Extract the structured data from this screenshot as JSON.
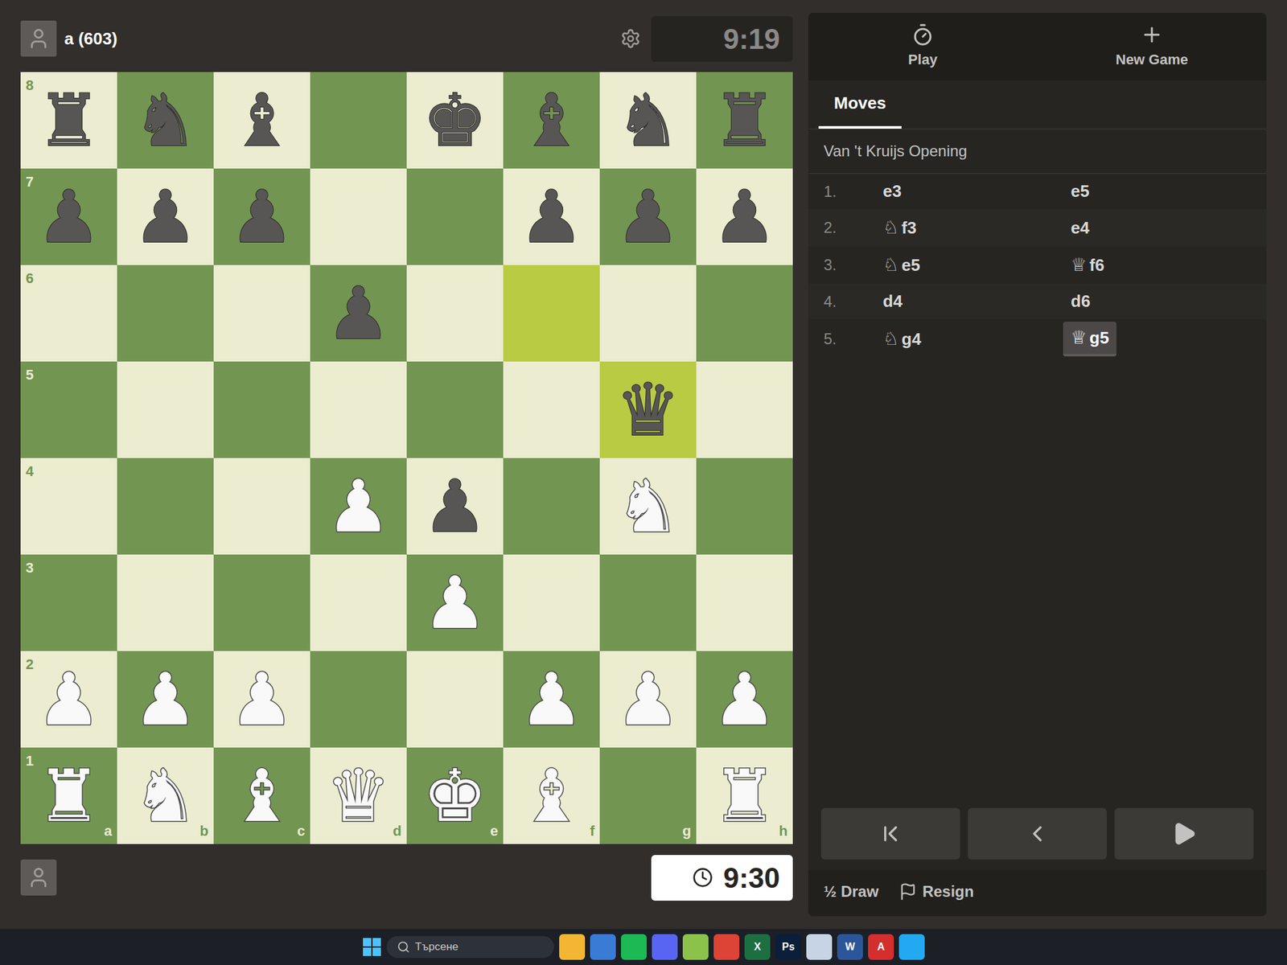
{
  "opponent": {
    "name": "a (603)",
    "clock": "9:19",
    "active": false
  },
  "player": {
    "clock": "9:30",
    "active": true
  },
  "board": {
    "files": [
      "a",
      "b",
      "c",
      "d",
      "e",
      "f",
      "g",
      "h"
    ],
    "ranks": [
      {
        "label": "8",
        "squares": [
          {
            "piece": "♜",
            "side": "black",
            "highlighted": false
          },
          {
            "piece": "♞",
            "side": "black",
            "highlighted": false
          },
          {
            "piece": "♝",
            "side": "black",
            "highlighted": false
          },
          {
            "piece": "",
            "side": "",
            "highlighted": false
          },
          {
            "piece": "♚",
            "side": "black",
            "highlighted": false
          },
          {
            "piece": "♝",
            "side": "black",
            "highlighted": false
          },
          {
            "piece": "♞",
            "side": "black",
            "highlighted": false
          },
          {
            "piece": "♜",
            "side": "black",
            "highlighted": false
          }
        ]
      },
      {
        "label": "7",
        "squares": [
          {
            "piece": "♟",
            "side": "black",
            "highlighted": false
          },
          {
            "piece": "♟",
            "side": "black",
            "highlighted": false
          },
          {
            "piece": "♟",
            "side": "black",
            "highlighted": false
          },
          {
            "piece": "",
            "side": "",
            "highlighted": false
          },
          {
            "piece": "",
            "side": "",
            "highlighted": false
          },
          {
            "piece": "♟",
            "side": "black",
            "highlighted": false
          },
          {
            "piece": "♟",
            "side": "black",
            "highlighted": false
          },
          {
            "piece": "♟",
            "side": "black",
            "highlighted": false
          }
        ]
      },
      {
        "label": "6",
        "squares": [
          {
            "piece": "",
            "side": "",
            "highlighted": false
          },
          {
            "piece": "",
            "side": "",
            "highlighted": false
          },
          {
            "piece": "",
            "side": "",
            "highlighted": false
          },
          {
            "piece": "♟",
            "side": "black",
            "highlighted": false
          },
          {
            "piece": "",
            "side": "",
            "highlighted": false
          },
          {
            "piece": "",
            "side": "",
            "highlighted": true
          },
          {
            "piece": "",
            "side": "",
            "highlighted": false
          },
          {
            "piece": "",
            "side": "",
            "highlighted": false
          }
        ]
      },
      {
        "label": "5",
        "squares": [
          {
            "piece": "",
            "side": "",
            "highlighted": false
          },
          {
            "piece": "",
            "side": "",
            "highlighted": false
          },
          {
            "piece": "",
            "side": "",
            "highlighted": false
          },
          {
            "piece": "",
            "side": "",
            "highlighted": false
          },
          {
            "piece": "",
            "side": "",
            "highlighted": false
          },
          {
            "piece": "",
            "side": "",
            "highlighted": false
          },
          {
            "piece": "♛",
            "side": "black",
            "highlighted": true
          },
          {
            "piece": "",
            "side": "",
            "highlighted": false
          }
        ]
      },
      {
        "label": "4",
        "squares": [
          {
            "piece": "",
            "side": "",
            "highlighted": false
          },
          {
            "piece": "",
            "side": "",
            "highlighted": false
          },
          {
            "piece": "",
            "side": "",
            "highlighted": false
          },
          {
            "piece": "♟",
            "side": "white",
            "highlighted": false
          },
          {
            "piece": "♟",
            "side": "black",
            "highlighted": false
          },
          {
            "piece": "",
            "side": "",
            "highlighted": false
          },
          {
            "piece": "♞",
            "side": "white",
            "highlighted": false
          },
          {
            "piece": "",
            "side": "",
            "highlighted": false
          }
        ]
      },
      {
        "label": "3",
        "squares": [
          {
            "piece": "",
            "side": "",
            "highlighted": false
          },
          {
            "piece": "",
            "side": "",
            "highlighted": false
          },
          {
            "piece": "",
            "side": "",
            "highlighted": false
          },
          {
            "piece": "",
            "side": "",
            "highlighted": false
          },
          {
            "piece": "♟",
            "side": "white",
            "highlighted": false
          },
          {
            "piece": "",
            "side": "",
            "highlighted": false
          },
          {
            "piece": "",
            "side": "",
            "highlighted": false
          },
          {
            "piece": "",
            "side": "",
            "highlighted": false
          }
        ]
      },
      {
        "label": "2",
        "squares": [
          {
            "piece": "♟",
            "side": "white",
            "highlighted": false
          },
          {
            "piece": "♟",
            "side": "white",
            "highlighted": false
          },
          {
            "piece": "♟",
            "side": "white",
            "highlighted": false
          },
          {
            "piece": "",
            "side": "",
            "highlighted": false
          },
          {
            "piece": "",
            "side": "",
            "highlighted": false
          },
          {
            "piece": "♟",
            "side": "white",
            "highlighted": false
          },
          {
            "piece": "♟",
            "side": "white",
            "highlighted": false
          },
          {
            "piece": "♟",
            "side": "white",
            "highlighted": false
          }
        ]
      },
      {
        "label": "1",
        "squares": [
          {
            "piece": "♜",
            "side": "white",
            "highlighted": false
          },
          {
            "piece": "♞",
            "side": "white",
            "highlighted": false
          },
          {
            "piece": "♝",
            "side": "white",
            "highlighted": false
          },
          {
            "piece": "♛",
            "side": "white",
            "highlighted": false
          },
          {
            "piece": "♚",
            "side": "white",
            "highlighted": false
          },
          {
            "piece": "♝",
            "side": "white",
            "highlighted": false
          },
          {
            "piece": "",
            "side": "",
            "highlighted": false
          },
          {
            "piece": "♜",
            "side": "white",
            "highlighted": false
          }
        ]
      }
    ]
  },
  "panel": {
    "header_buttons": [
      "Play",
      "New Game"
    ],
    "tabs": [
      {
        "label": "Moves",
        "selected": true
      }
    ],
    "opening": "Van 't Kruijs Opening",
    "moves": [
      {
        "number": "1.",
        "white": {
          "piece": "",
          "square": "e3",
          "selected": false
        },
        "black": {
          "piece": "",
          "square": "e5",
          "selected": false
        }
      },
      {
        "number": "2.",
        "white": {
          "piece": "♘",
          "square": "f3",
          "selected": false
        },
        "black": {
          "piece": "",
          "square": "e4",
          "selected": false
        }
      },
      {
        "number": "3.",
        "white": {
          "piece": "♘",
          "square": "e5",
          "selected": false
        },
        "black": {
          "piece": "♕",
          "square": "f6",
          "selected": false
        }
      },
      {
        "number": "4.",
        "white": {
          "piece": "",
          "square": "d4",
          "selected": false
        },
        "black": {
          "piece": "",
          "square": "d6",
          "selected": false
        }
      },
      {
        "number": "5.",
        "white": {
          "piece": "♘",
          "square": "g4",
          "selected": false
        },
        "black": {
          "piece": "♕",
          "square": "g5",
          "selected": true
        }
      }
    ],
    "draw_button": "½ Draw",
    "resign_button": "Resign"
  },
  "taskbar": {
    "search_placeholder": "Търсене",
    "apps": [
      {
        "label": "",
        "color": "#f2b632"
      },
      {
        "label": "",
        "color": "#3a7bd5"
      },
      {
        "label": "",
        "color": "#1db954"
      },
      {
        "label": "",
        "color": "#5865f2"
      },
      {
        "label": "",
        "color": "#8bc34a"
      },
      {
        "label": "",
        "color": "#db4437"
      },
      {
        "label": "X",
        "color": "#1d6f42"
      },
      {
        "label": "Ps",
        "color": "#0b1f3a"
      },
      {
        "label": "",
        "color": "#c7d4e6"
      },
      {
        "label": "W",
        "color": "#2b579a"
      },
      {
        "label": "A",
        "color": "#d32f2f"
      },
      {
        "label": "",
        "color": "#23a9f2"
      }
    ]
  }
}
